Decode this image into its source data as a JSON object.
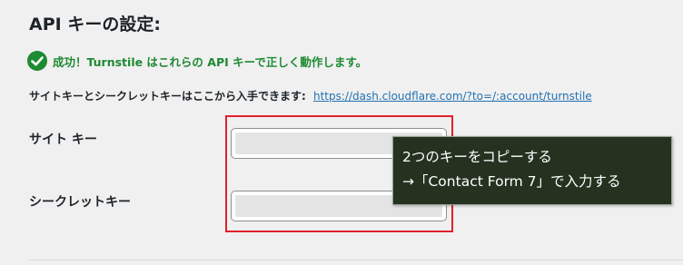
{
  "section": {
    "title": "API キーの設定:"
  },
  "notice": {
    "icon": "check-circle-icon",
    "status_color": "#1e8a32",
    "text": "成功！Turnstile はこれらの API キーで正しく動作します。"
  },
  "help": {
    "text": "サイトキーとシークレットキーはここから入手できます:",
    "link_text": "https://dash.cloudflare.com/?to=/:account/turnstile",
    "link_color": "#2271b1"
  },
  "fields": {
    "site_key": {
      "label": "サイト キー"
    },
    "secret_key": {
      "label": "シークレットキー"
    }
  },
  "annotation": {
    "highlight_color": "#e2202d",
    "callout_line1": "2つのキーをコピーする",
    "callout_line2": "→「Contact Form 7」で入力する"
  }
}
